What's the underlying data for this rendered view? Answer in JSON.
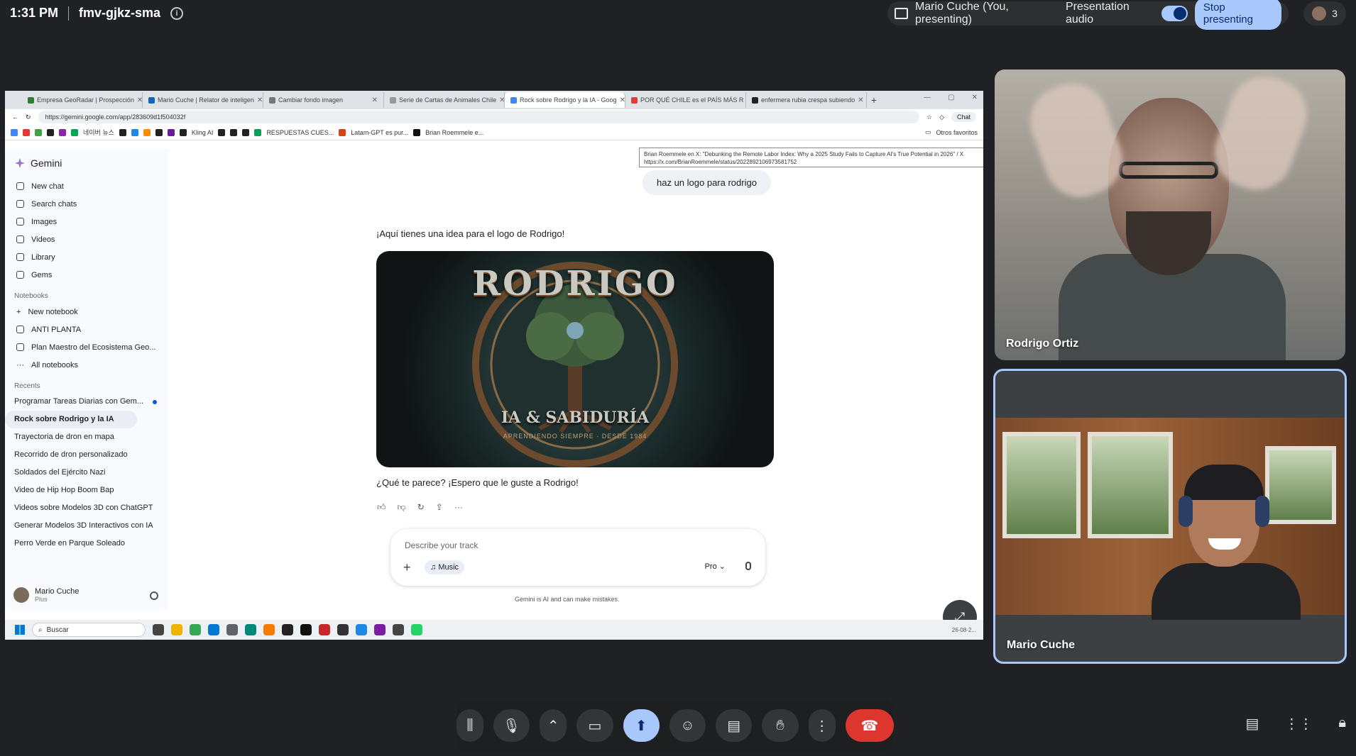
{
  "meet": {
    "time": "1:31 PM",
    "meeting_code": "fmv-gjkz-sma",
    "presenter_label": "Mario Cuche (You, presenting)",
    "audio_label": "Presentation audio",
    "stop_label": "Stop presenting",
    "participant_count": "3"
  },
  "browser": {
    "tabs": [
      {
        "title": "Empresa GeoRadar | Prospección",
        "color": "#2e7d32"
      },
      {
        "title": "Mario Cuche | Relator de inteligen",
        "color": "#1565c0"
      },
      {
        "title": "Cambiar fondo imagen",
        "color": "#777777"
      },
      {
        "title": "Serie de Cartas de Animales Chile",
        "color": "#999999"
      },
      {
        "title": "Rock sobre Rodrigo y la IA - Goog",
        "color": "#4285f4"
      },
      {
        "title": "POR QUÉ CHILE es el PAÍS MÁS R",
        "color": "#e53935"
      },
      {
        "title": "enfermera rubia crespa subiendo",
        "color": "#222222"
      }
    ],
    "url": "https://gemini.google.com/app/283609d1f504032f",
    "chat_label": "Chat",
    "bookmarks": [
      "네이버 뉴스",
      "Kling AI",
      "RESPUESTAS CUES...",
      "Latam-GPT es pur...",
      "Brian Roemmele e..."
    ],
    "other_bookmarks": "Otros favoritos",
    "tooltip_line1": "Brian Roemmele en X: \"Debunking the Remote Labor Index: Why a 2025 Study Fails to Capture AI's True Potential in 2026\" / X",
    "tooltip_line2": "https://x.com/BrianRoemmele/status/2022892106973581752"
  },
  "gemini": {
    "brand": "Gemini",
    "nav": [
      {
        "label": "New chat"
      },
      {
        "label": "Search chats"
      },
      {
        "label": "Images"
      },
      {
        "label": "Videos"
      },
      {
        "label": "Library"
      },
      {
        "label": "Gems"
      }
    ],
    "notebooks_heading": "Notebooks",
    "notebooks": [
      {
        "label": "New notebook"
      },
      {
        "label": "ANTI PLANTA"
      },
      {
        "label": "Plan Maestro del Ecosistema Geo..."
      },
      {
        "label": "All notebooks"
      }
    ],
    "recents_heading": "Recents",
    "recents": [
      {
        "label": "Programar Tareas Diarias con Gem..."
      },
      {
        "label": "Rock sobre Rodrigo y la IA"
      },
      {
        "label": "Trayectoria de dron en mapa"
      },
      {
        "label": "Recorrido de dron personalizado"
      },
      {
        "label": "Soldados del Ejército Nazi"
      },
      {
        "label": "Video de Hip Hop Boom Bap"
      },
      {
        "label": "Videos sobre Modelos 3D con ChatGPT"
      },
      {
        "label": "Generar Modelos 3D Interactivos con IA"
      },
      {
        "label": "Perro Verde en Parque Soleado"
      }
    ],
    "user_name": "Mario Cuche",
    "user_plan": "Plus",
    "user_message": "haz un logo para rodrigo",
    "response_intro": "¡Aquí tienes una idea para el logo de Rodrigo!",
    "logo_title": "RODRIGO",
    "logo_subtitle": "IA & SABIDURÍA",
    "logo_tagline": "APRENDIENDO SIEMPRE · DESDE 1984",
    "response_after": "¿Qué te parece? ¡Espero que le guste a Rodrigo!",
    "composer_placeholder": "Describe your track",
    "music_chip": "Music",
    "model": "Pro",
    "disclaimer": "Gemini is AI and can make mistakes."
  },
  "taskbar": {
    "search_label": "Buscar",
    "date": "26-08-2..."
  },
  "participants": {
    "rodrigo": "Rodrigo Ortiz",
    "mario": "Mario Cuche"
  },
  "colors": {
    "accent": "#a8c7fa",
    "hangup": "#dc362e",
    "background": "#202124"
  }
}
